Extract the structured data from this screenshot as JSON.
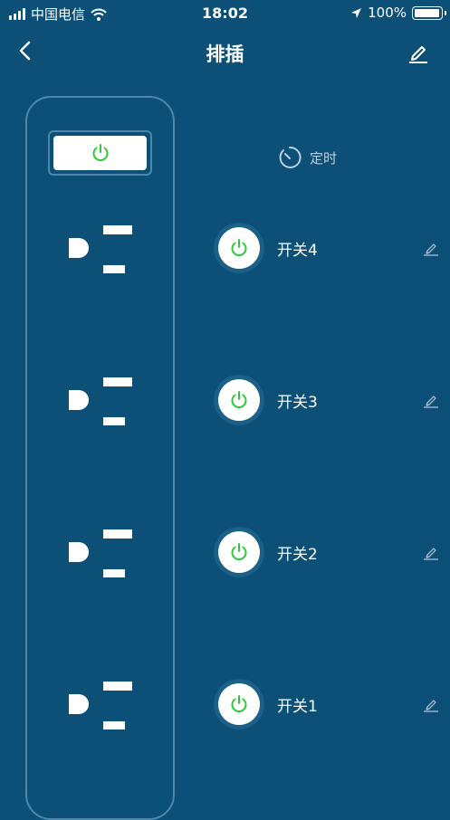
{
  "status_bar": {
    "carrier": "中国电信",
    "time": "18:02",
    "battery": "100%",
    "battery_level": 1.0
  },
  "nav": {
    "title": "排插"
  },
  "timer": {
    "label": "定时"
  },
  "switches": [
    {
      "label": "开关4"
    },
    {
      "label": "开关3"
    },
    {
      "label": "开关2"
    },
    {
      "label": "开关1"
    }
  ],
  "colors": {
    "background": "#0c5078",
    "power_green": "#2ec93c",
    "panel_border": "#4d88ab"
  }
}
